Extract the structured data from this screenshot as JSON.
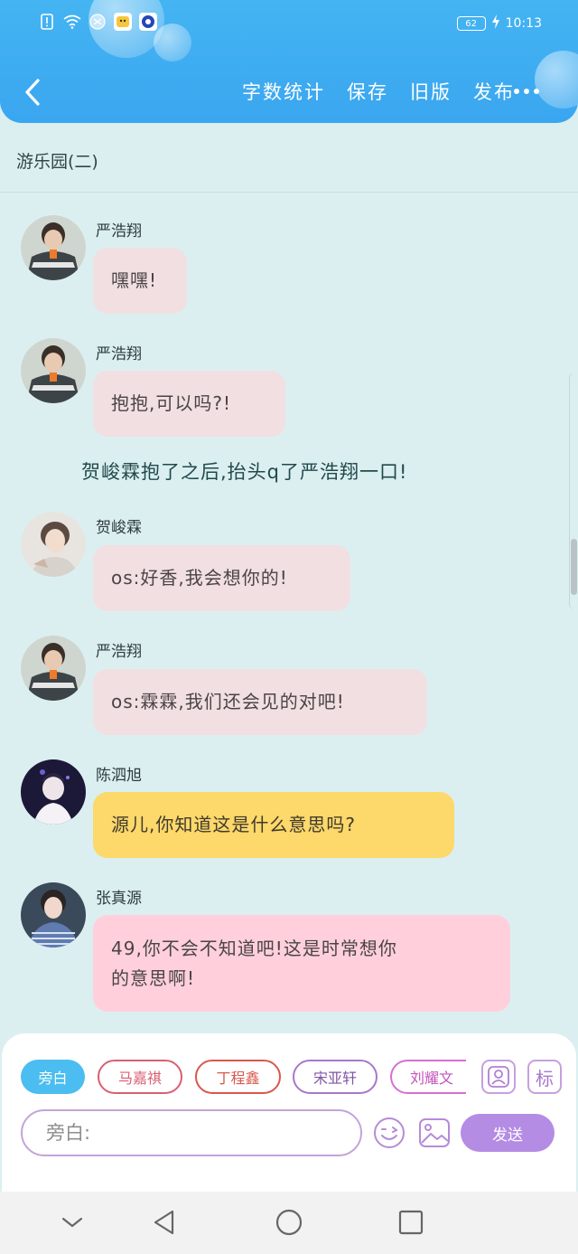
{
  "status_bar": {
    "battery": "62",
    "time": "10:13",
    "icons": [
      "alert-icon",
      "wifi-icon",
      "vpn-icon",
      "app-notification-icon",
      "app-notification-icon"
    ]
  },
  "header": {
    "back_icon": "chevron-left-icon",
    "actions": [
      "字数统计",
      "保存",
      "旧版",
      "发布"
    ],
    "more_icon": "more-dots-icon",
    "background": "#3aa6f0"
  },
  "story": {
    "title": "游乐园(二)"
  },
  "messages": [
    {
      "sender": "严浩翔",
      "text": "嘿嘿!"
    },
    {
      "sender": "严浩翔",
      "text": "抱抱,可以吗?!"
    },
    {
      "narration": "贺峻霖抱了之后,抬头q了严浩翔一口!"
    },
    {
      "sender": "贺峻霖",
      "text": "os:好香,我会想你的!"
    },
    {
      "sender": "严浩翔",
      "text": "os:霖霖,我们还会见的对吧!"
    },
    {
      "sender": "陈泗旭",
      "text": "源儿,你知道这是什么意思吗?"
    },
    {
      "sender": "张真源",
      "text_lines": [
        "49,你不会不知道吧!这是时常想你",
        "的意思啊!"
      ]
    }
  ],
  "bubble_colors": {
    "default": "#f2dfe1",
    "yellow": "#fdd86a",
    "rose": "#ffd0dc"
  },
  "composer": {
    "characters": [
      "旁白",
      "马嘉祺",
      "丁程鑫",
      "宋亚轩",
      "刘耀文"
    ],
    "character_icon": "person-card-icon",
    "tag_label": "标",
    "input_placeholder": "旁白:",
    "emoji_icon": "emoji-icon",
    "image_icon": "image-icon",
    "send_label": "发送",
    "send_color": "#b48ce4"
  },
  "system_nav": [
    "chevron-down-icon",
    "back-triangle-icon",
    "home-circle-icon",
    "recents-square-icon"
  ]
}
